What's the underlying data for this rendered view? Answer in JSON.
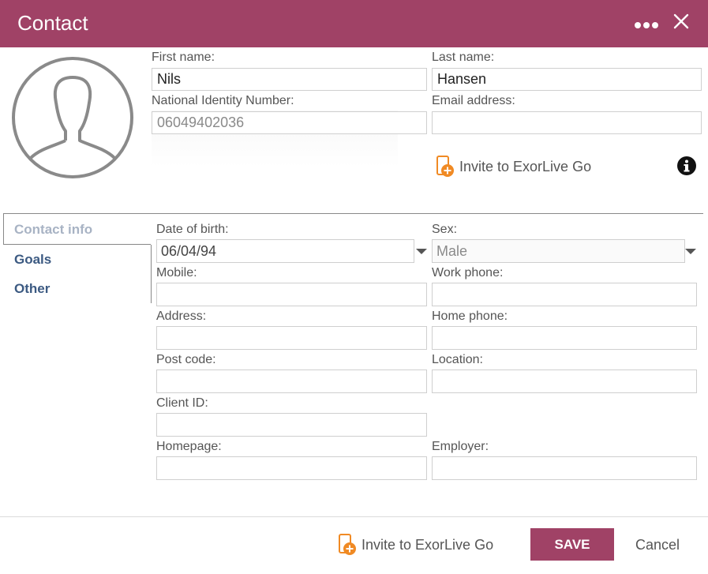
{
  "header": {
    "title": "Contact"
  },
  "person": {
    "first_name_label": "First name:",
    "first_name_value": "Nils",
    "last_name_label": "Last name:",
    "last_name_value": "Hansen",
    "nin_label": "National Identity Number:",
    "nin_value": "06049402036",
    "email_label": "Email address:",
    "email_value": ""
  },
  "invite": {
    "label": "Invite to ExorLive Go"
  },
  "tabs": [
    {
      "label": "Contact info",
      "active": true
    },
    {
      "label": "Goals",
      "active": false
    },
    {
      "label": "Other",
      "active": false
    }
  ],
  "form": {
    "dob_label": "Date of birth:",
    "dob_value": "06/04/94",
    "sex_label": "Sex:",
    "sex_value": "Male",
    "mobile_label": "Mobile:",
    "work_phone_label": "Work phone:",
    "address_label": "Address:",
    "home_phone_label": "Home phone:",
    "post_code_label": "Post code:",
    "location_label": "Location:",
    "client_id_label": "Client ID:",
    "homepage_label": "Homepage:",
    "employer_label": "Employer:"
  },
  "footer": {
    "invite_label": "Invite to ExorLive Go",
    "save_label": "SAVE",
    "cancel_label": "Cancel"
  },
  "colors": {
    "brand": "#a04266",
    "invite_icon": "#f08a24",
    "tab_active": "#a8b3c4",
    "tab_normal": "#3c5a82"
  }
}
